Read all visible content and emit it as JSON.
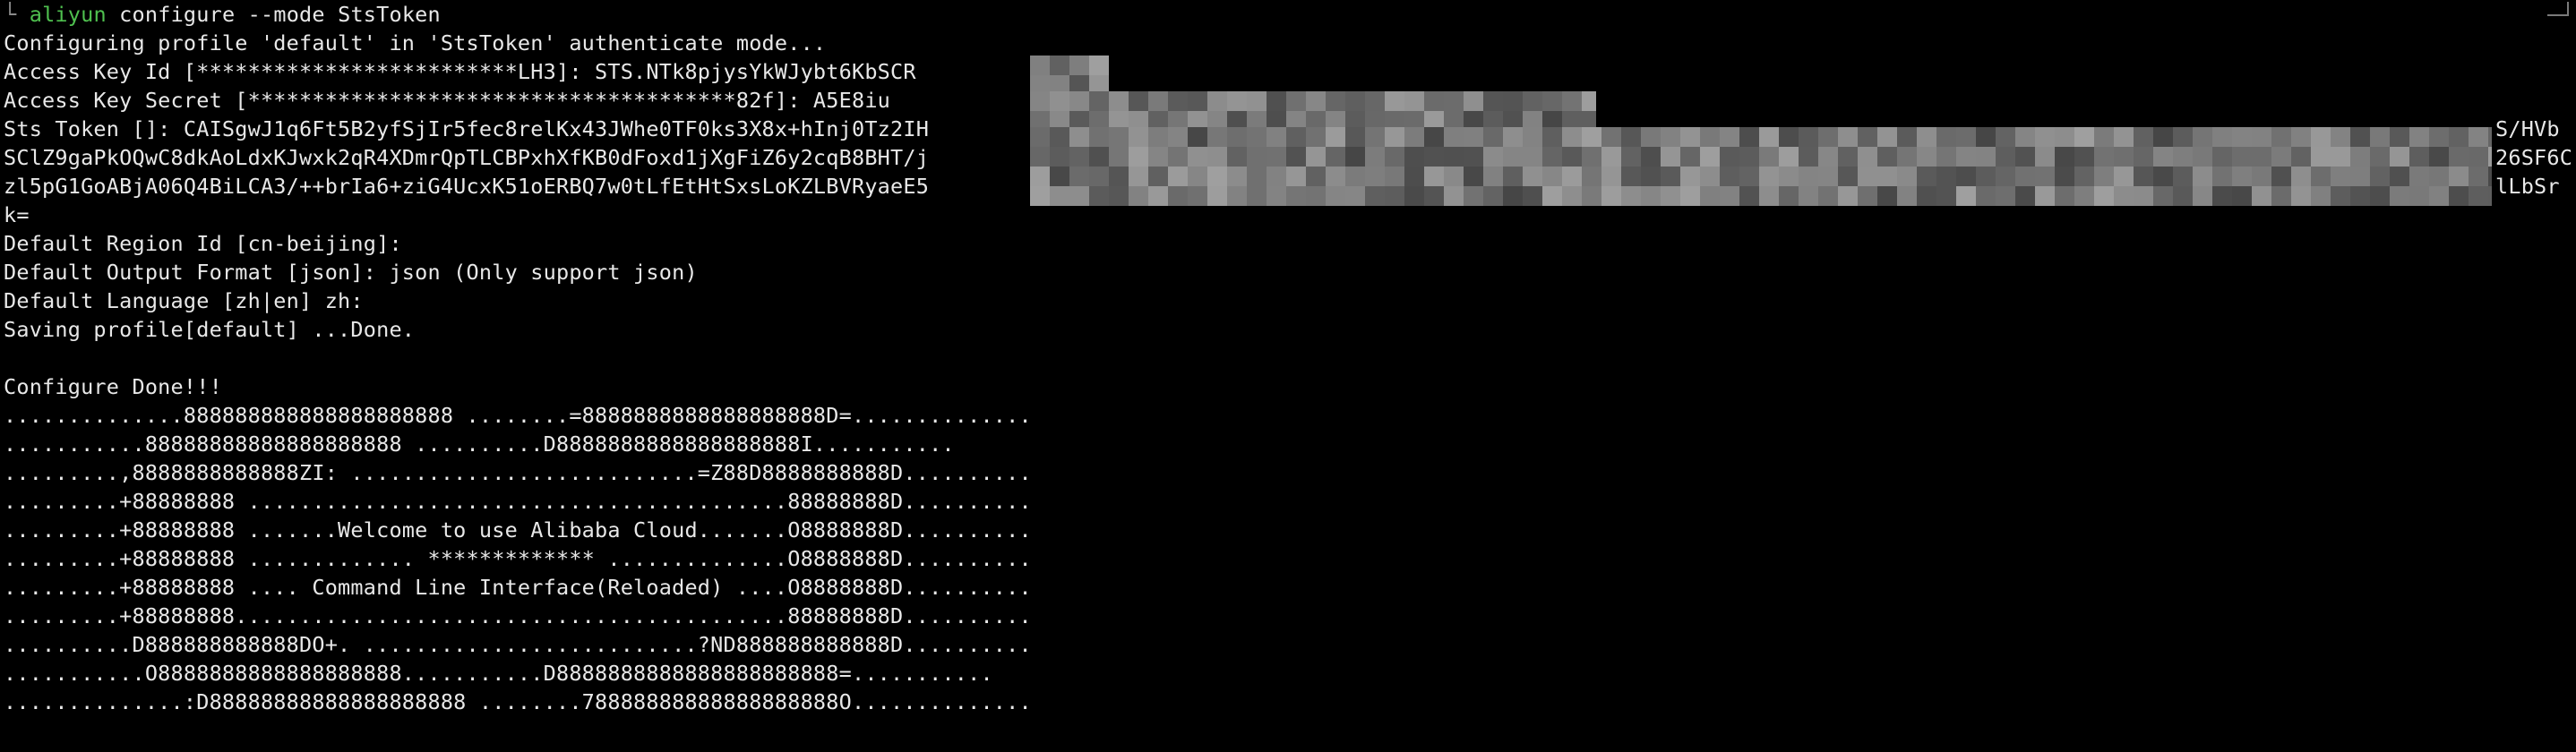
{
  "terminal": {
    "prompt_corner": "└",
    "command": {
      "program": "aliyun",
      "args": "configure --mode StsToken"
    },
    "lines": [
      "Configuring profile 'default' in 'StsToken' authenticate mode...",
      "Access Key Id [*************************LH3]: STS.NTk8pjysYkWJybt6KbSCR",
      "Access Key Secret [**************************************82f]: A5E8iu",
      "Sts Token []: CAISgwJ1q6Ft5B2yfSjIr5fec8relKx43JWhe0TF0ks3X8x+hInj0Tz2IH",
      "SClZ9gaPkOQwC8dkAoLdxKJwxk2qR4XDmrQpTLCBPxhXfKB0dFoxd1jXgFiZ6y2cqB8BHT/j",
      "zl5pG1GoABjA06Q4BiLCA3/++brIa6+ziG4UcxK51oERBQ7w0tLfEtHtSxsLoKZLBVRyaeE5",
      "k=",
      "Default Region Id [cn-beijing]:",
      "Default Output Format [json]: json (Only support json)",
      "Default Language [zh|en] zh:",
      "Saving profile[default] ...Done.",
      "",
      "Configure Done!!!",
      "..............888888888888888888888 ........=8888888888888888888D=..............",
      "...........88888888888888888888 ..........D8888888888888888888I...........",
      ".........,8888888888888ZI: ...........................=Z88D8888888888D..........",
      ".........+88888888 ..........................................88888888D..........",
      ".........+88888888 .......Welcome to use Alibaba Cloud.......O8888888D..........",
      ".........+88888888 ............. ************* ..............O8888888D..........",
      ".........+88888888 .... Command Line Interface(Reloaded) ....O8888888D..........",
      ".........+88888888...........................................88888888D..........",
      "..........D888888888888DO+. ..........................?ND888888888888D..........",
      "...........O8888888888888888888...........D8888888888888888888888=...........",
      "..............:D88888888888888888888 ........78888888888888888888O.............."
    ],
    "right_fragments": {
      "sts_token_end": "S/HVb",
      "line2_end": "26SF6C",
      "line3_end": "lLbSr"
    },
    "colors": {
      "background": "#000000",
      "text": "#e8e8e8",
      "command": "#4fc04f"
    }
  }
}
